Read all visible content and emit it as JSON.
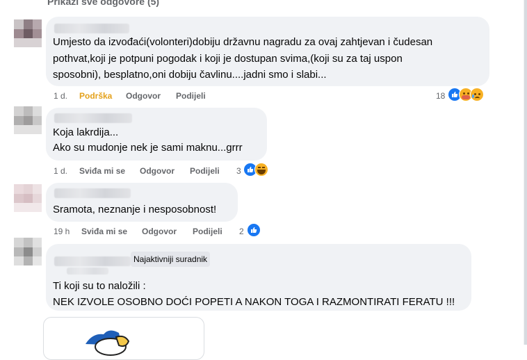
{
  "show_all_label": "Prikaži sve odgovore (5)",
  "comments": [
    {
      "text_lines": [
        "Umjesto da izvođaći(volonteri)dobiju državnu nagradu za ovaj zahtjevan i čudesan",
        "pothvat,koji je potpuni pogodak i koji je dostupan svima,(koji su za taj uspon",
        "sposobni), besplatno,oni dobiju čavlinu....jadni smo i slabi..."
      ],
      "time": "1 d.",
      "like_label": "Podrška",
      "reply_label": "Odgovor",
      "share_label": "Podijeli",
      "reaction_count": "18",
      "reactions": [
        "like-icon",
        "care-icon",
        "sad-icon"
      ]
    },
    {
      "text_lines": [
        "Koja lakrdija...",
        "Ako su mudonje nek je sami maknu...grrr"
      ],
      "time": "1 d.",
      "like_label": "Sviđa mi se",
      "reply_label": "Odgovor",
      "share_label": "Podijeli",
      "reaction_count": "3",
      "reactions": [
        "like-icon",
        "haha-icon"
      ]
    },
    {
      "text_lines": [
        "Sramota, neznanje i nesposobnost!"
      ],
      "time": "19 h",
      "like_label": "Sviđa mi se",
      "reply_label": "Odgovor",
      "share_label": "Podijeli",
      "reaction_count": "2",
      "reactions": [
        "like-icon"
      ]
    },
    {
      "badge": "Najaktivniji suradnik",
      "text_lines": [
        "Ti koji su to naložili :",
        "NEK IZVOLE OSOBNO DOĆI POPETI A NAKON TOGA I RAZMONTIRATI FERATU !!!"
      ]
    }
  ],
  "colors": {
    "bubble_bg": "#f0f2f5",
    "action_gray": "#65676b",
    "liked": "#e4a11b",
    "like_blue": "#1877f2",
    "emoji_yellow": "#f7b125"
  }
}
